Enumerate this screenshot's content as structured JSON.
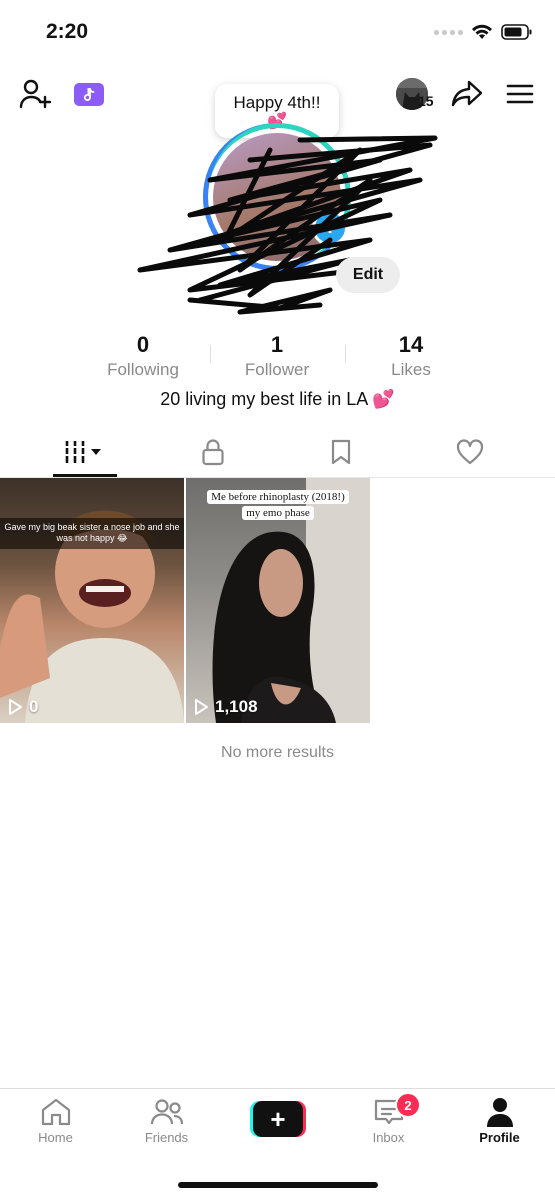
{
  "status_bar": {
    "time": "2:20"
  },
  "profile": {
    "note": "Happy 4th!!",
    "note_emoji": "💕",
    "story_count": "15",
    "edit_label": "Edit",
    "avatar_add": "+"
  },
  "stats": [
    {
      "value": "0",
      "label": "Following"
    },
    {
      "value": "1",
      "label": "Follower"
    },
    {
      "value": "14",
      "label": "Likes"
    }
  ],
  "bio": {
    "text": "20 living my best life in LA",
    "emoji": "💕"
  },
  "tabs": [
    "videos-icon",
    "lock-icon",
    "bookmark-icon",
    "heart-icon"
  ],
  "videos": [
    {
      "caption": "Gave my big beak sister a nose job and she was not happy 😂",
      "views": "0"
    },
    {
      "caption_line1": "Me before rhinoplasty (2018!)",
      "caption_line2": "my emo phase",
      "views": "1,108"
    }
  ],
  "no_more": "No more results",
  "nav": {
    "home": "Home",
    "friends": "Friends",
    "create": "+",
    "inbox": "Inbox",
    "inbox_badge": "2",
    "profile": "Profile"
  },
  "colors": {
    "accent": "#fe2c55",
    "cyan": "#25f4ee",
    "ticket": "#8b5cf6",
    "ring": "#2dd4bf"
  }
}
